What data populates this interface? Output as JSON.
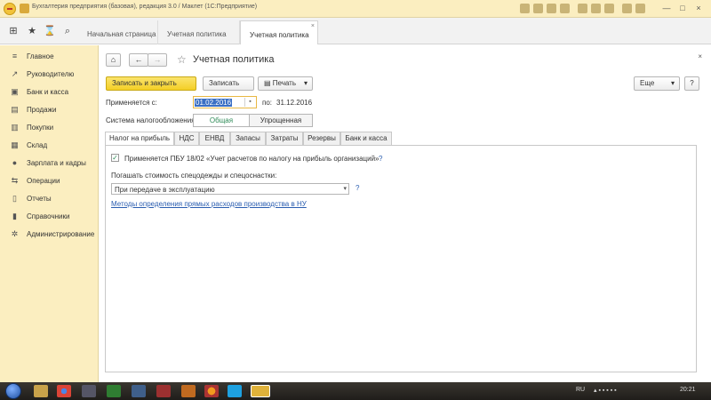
{
  "window": {
    "title": "Бухгалтерия предприятия (базовая), редакция 3.0 / Маклет  (1С:Предприятие)",
    "controls": [
      "—",
      "□",
      "×"
    ]
  },
  "tabs": [
    {
      "label": "Начальная страница"
    },
    {
      "label": "Учетная политика"
    },
    {
      "label": "Учетная политика",
      "close": "×"
    }
  ],
  "sidebar": {
    "items": [
      {
        "label": "Главное",
        "icon": "menu-icon"
      },
      {
        "label": "Руководителю",
        "icon": "chart-icon"
      },
      {
        "label": "Банк и касса",
        "icon": "bank-icon"
      },
      {
        "label": "Продажи",
        "icon": "cart-icon"
      },
      {
        "label": "Покупки",
        "icon": "basket-icon"
      },
      {
        "label": "Склад",
        "icon": "warehouse-icon"
      },
      {
        "label": "Зарплата и кадры",
        "icon": "person-icon"
      },
      {
        "label": "Операции",
        "icon": "operations-icon"
      },
      {
        "label": "Отчеты",
        "icon": "reports-icon"
      },
      {
        "label": "Справочники",
        "icon": "books-icon"
      },
      {
        "label": "Администрирование",
        "icon": "gear-icon"
      }
    ]
  },
  "form": {
    "title": "Учетная политика",
    "close": "×",
    "nav": {
      "home": "⌂",
      "back": "←",
      "forward": "→",
      "star": "☆"
    },
    "toolbar": {
      "save_close": "Записать и закрыть",
      "save": "Записать",
      "print": "Печать",
      "print_arrow": "▾",
      "more": "Еще",
      "more_arrow": "▾",
      "help": "?"
    },
    "applies_from_label": "Применяется с:",
    "applies_from_value": "01.02.2016",
    "applies_to_label": "по:",
    "applies_to_value": "31.12.2016",
    "tax_system_label": "Система налогообложения:",
    "tax_system_options": [
      "Общая",
      "Упрощенная"
    ],
    "tax_system_selected": "Общая",
    "form_tabs": [
      "Налог на прибыль",
      "НДС",
      "ЕНВД",
      "Запасы",
      "Затраты",
      "Резервы",
      "Банк и касса"
    ],
    "active_form_tab": "Налог на прибыль",
    "checkbox_label": "Применяется ПБУ 18/02 «Учет расчетов по налогу на прибыль организаций»",
    "checkbox_help": "?",
    "workwear_label": "Погашать стоимость спецодежды и спецоснастки:",
    "workwear_value": "При передаче в эксплуатацию",
    "workwear_help": "?",
    "link": "Методы определения прямых расходов производства в НУ"
  },
  "taskbar": {
    "lang": "RU",
    "time": "20:21"
  },
  "colors": {
    "sidebar_bg": "#fbeec0",
    "primary_button": "#f4cf26",
    "link": "#2a5db0",
    "accent_green": "#2e8b57"
  }
}
